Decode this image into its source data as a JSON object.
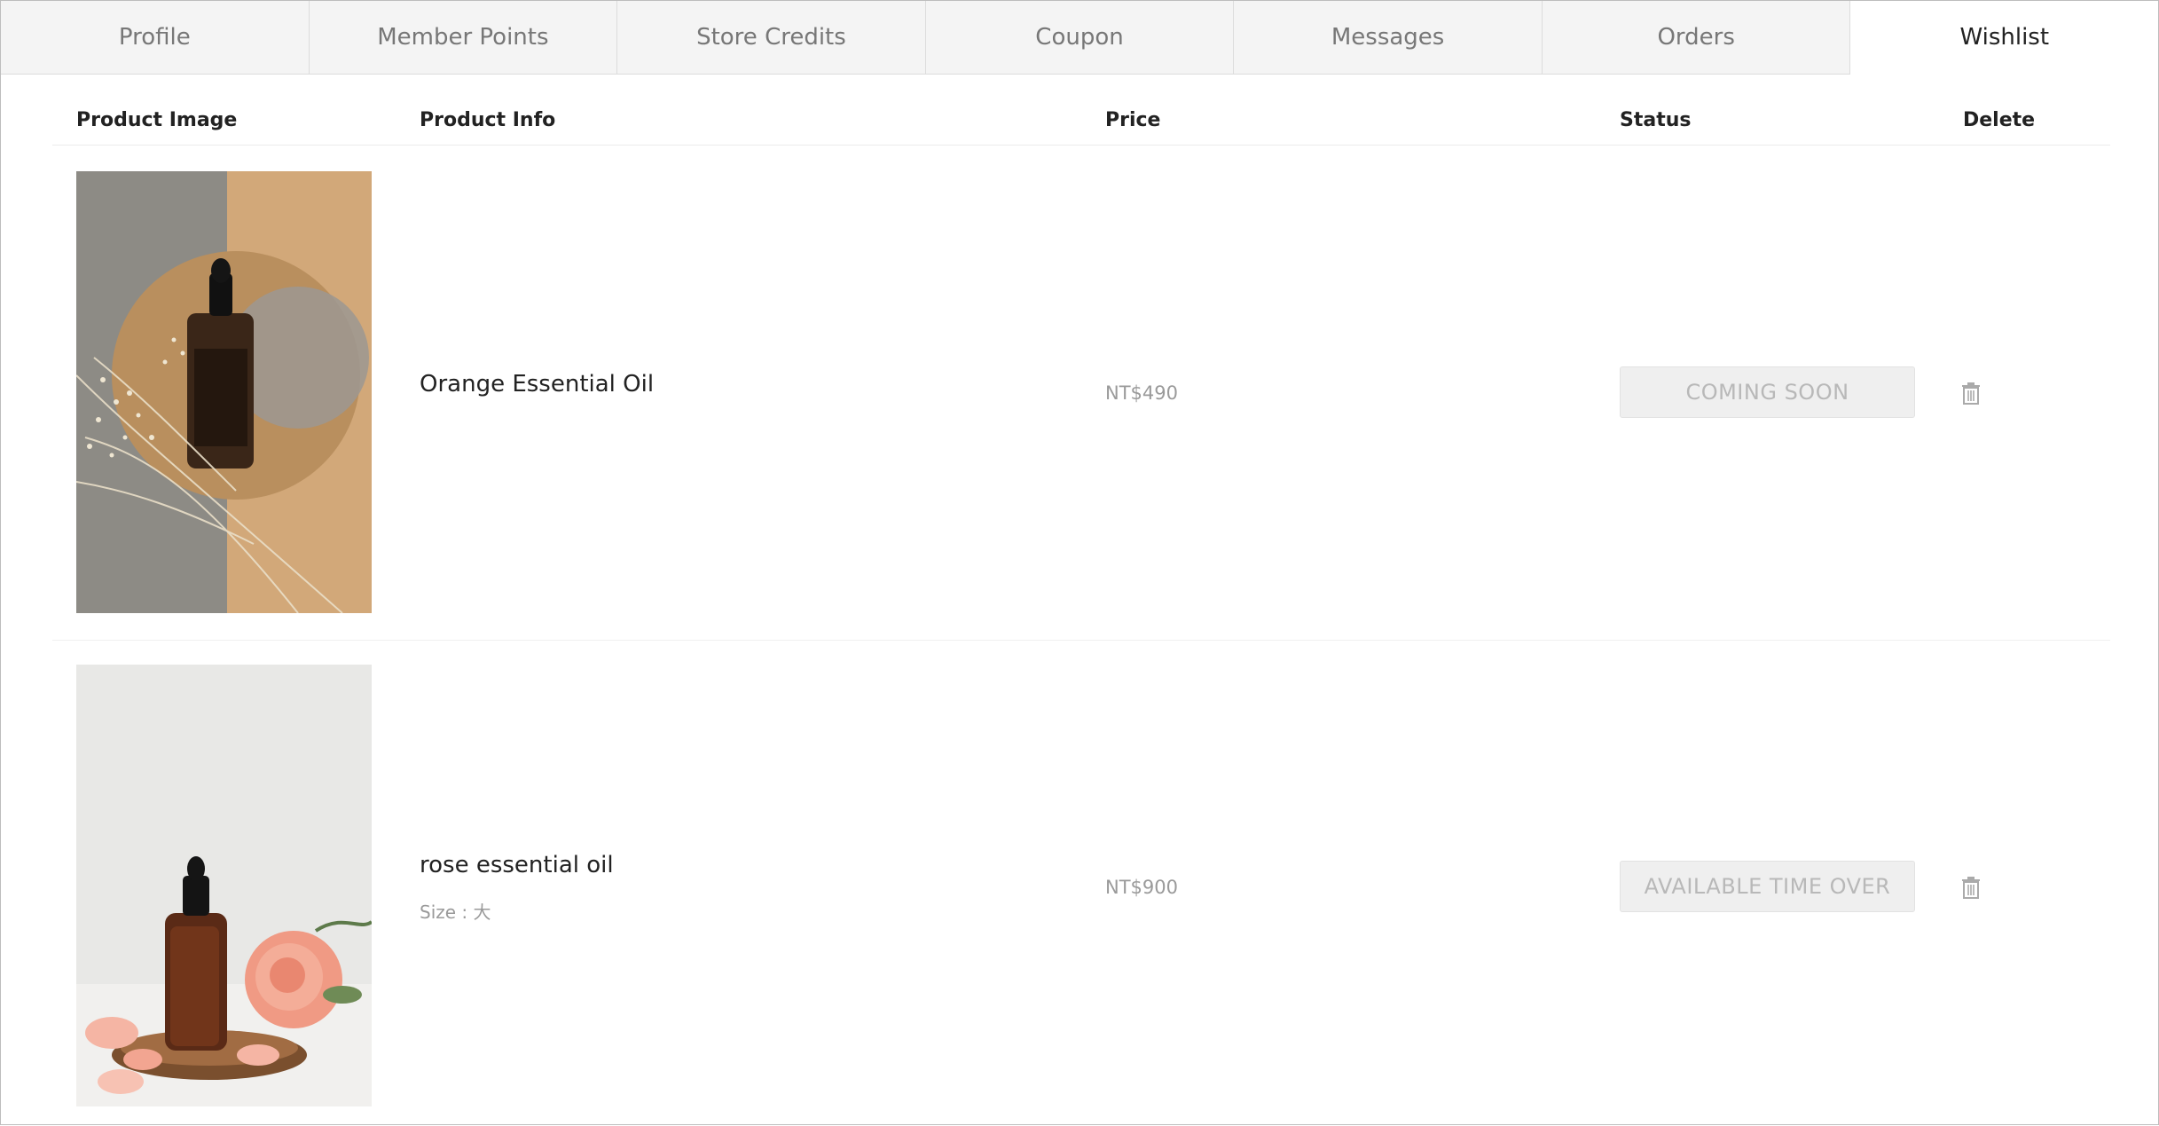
{
  "tabs": [
    {
      "label": "Profile"
    },
    {
      "label": "Member Points"
    },
    {
      "label": "Store Credits"
    },
    {
      "label": "Coupon"
    },
    {
      "label": "Messages"
    },
    {
      "label": "Orders"
    },
    {
      "label": "Wishlist",
      "active": true
    }
  ],
  "table": {
    "headers": {
      "image": "Product Image",
      "info": "Product Info",
      "price": "Price",
      "status": "Status",
      "delete": "Delete"
    },
    "rows": [
      {
        "name": "Orange Essential Oil",
        "variant": "",
        "price": "NT$490",
        "status": "COMING SOON",
        "delete_icon": "trash-icon"
      },
      {
        "name": "rose essential oil",
        "variant": "Size : 大",
        "price": "NT$900",
        "status": "AVAILABLE TIME OVER",
        "delete_icon": "trash-icon"
      }
    ]
  },
  "colors": {
    "tab_bg": "#f4f4f4",
    "active_tab_bg": "#ffffff",
    "status_bg": "#efefef",
    "status_text": "#b8b8b8"
  }
}
